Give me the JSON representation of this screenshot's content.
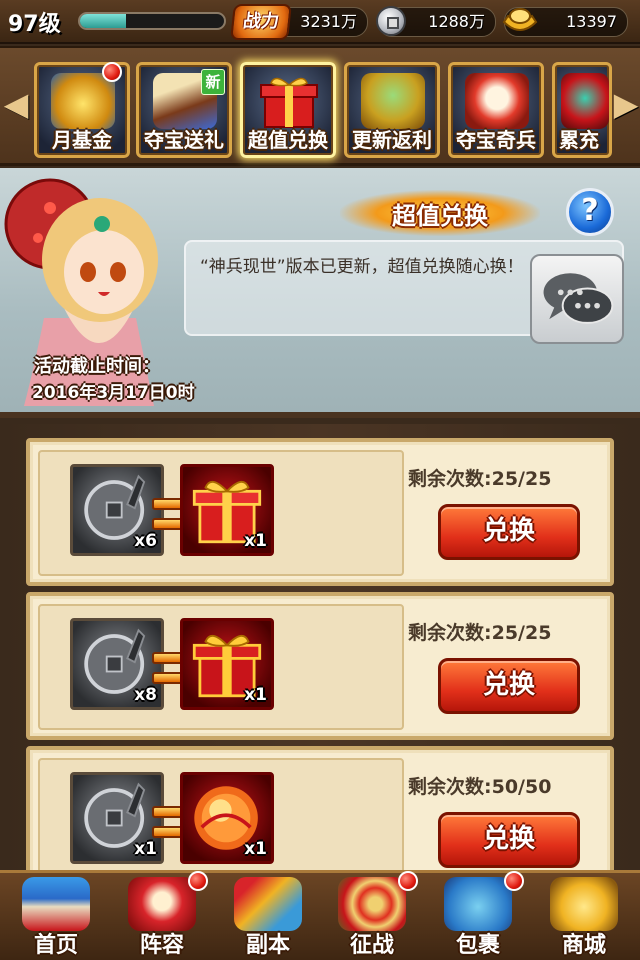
{
  "status": {
    "level": "97级",
    "xp_fraction": 0.32,
    "power_label": "战力",
    "power_value": "3231万",
    "coins": "1288万",
    "gold": "13397"
  },
  "tabs": [
    {
      "label": "月基金",
      "icon": "gold-coins-bowl-icon",
      "badge": true,
      "is_new": false
    },
    {
      "label": "夺宝送礼",
      "icon": "scroll-icon",
      "badge": false,
      "is_new": true
    },
    {
      "label": "超值兑换",
      "icon": "gift-box-icon",
      "badge": false,
      "is_new": false,
      "active": true
    },
    {
      "label": "更新返利",
      "icon": "treasure-pot-icon",
      "badge": false,
      "is_new": false
    },
    {
      "label": "夺宝奇兵",
      "icon": "drum-icon",
      "badge": false,
      "is_new": false
    },
    {
      "label": "累充",
      "icon": "helmet-icon",
      "badge": false,
      "is_new": false
    }
  ],
  "new_tag": "新",
  "banner": {
    "title": "超值兑换",
    "description": "“神兵现世”版本已更新，超值兑换随心换！",
    "deadline_label": "活动截止时间：",
    "deadline_value": "2016年3月17日0时",
    "help_label": "?"
  },
  "exchanges": [
    {
      "cost_qty": "x6",
      "reward_qty": "x1",
      "reward": "gift-box",
      "remain_label": "剩余次数:",
      "remain": "25/25",
      "button": "兑换"
    },
    {
      "cost_qty": "x8",
      "reward_qty": "x1",
      "reward": "gift-box",
      "remain_label": "剩余次数:",
      "remain": "25/25",
      "button": "兑换"
    },
    {
      "cost_qty": "x1",
      "reward_qty": "x1",
      "reward": "fire-orb",
      "remain_label": "剩余次数:",
      "remain": "50/50",
      "button": "兑换"
    }
  ],
  "nav": [
    {
      "label": "首页",
      "icon": "palace-icon",
      "badge": false
    },
    {
      "label": "阵容",
      "icon": "war-banner-icon",
      "badge": true
    },
    {
      "label": "副本",
      "icon": "crossed-weapons-icon",
      "badge": false
    },
    {
      "label": "征战",
      "icon": "target-arrows-icon",
      "badge": true
    },
    {
      "label": "包裹",
      "icon": "bag-icon",
      "badge": true
    },
    {
      "label": "商城",
      "icon": "gold-ingots-icon",
      "badge": false
    }
  ],
  "colors": {
    "accent_red": "#e2301a",
    "frame_gold": "#d9a648",
    "card_bg": "#f7ecd0"
  }
}
